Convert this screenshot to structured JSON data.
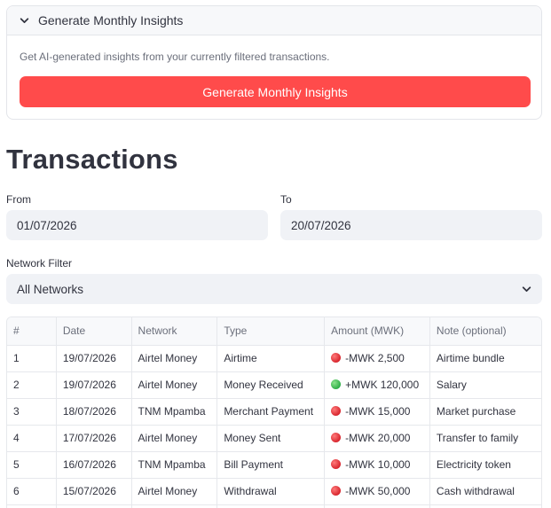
{
  "expander": {
    "title": "Generate Monthly Insights",
    "description": "Get AI-generated insights from your currently filtered transactions.",
    "button_label": "Generate Monthly Insights"
  },
  "page_title": "Transactions",
  "filters": {
    "from_label": "From",
    "from_value": "01/07/2026",
    "to_label": "To",
    "to_value": "20/07/2026",
    "network_label": "Network Filter",
    "network_value": "All Networks"
  },
  "colors": {
    "primary": "#ff4b4b",
    "negative": "#d8262e",
    "positive": "#2fae48"
  },
  "table": {
    "headers": [
      "#",
      "Date",
      "Network",
      "Type",
      "Amount (MWK)",
      "Note (optional)"
    ],
    "rows": [
      {
        "num": "1",
        "date": "19/07/2026",
        "network": "Airtel Money",
        "type": "Airtime",
        "sign": "negative",
        "amount": "-MWK 2,500",
        "note": "Airtime bundle"
      },
      {
        "num": "2",
        "date": "19/07/2026",
        "network": "Airtel Money",
        "type": "Money Received",
        "sign": "positive",
        "amount": "+MWK 120,000",
        "note": "Salary"
      },
      {
        "num": "3",
        "date": "18/07/2026",
        "network": "TNM Mpamba",
        "type": "Merchant Payment",
        "sign": "negative",
        "amount": "-MWK 15,000",
        "note": "Market purchase"
      },
      {
        "num": "4",
        "date": "17/07/2026",
        "network": "Airtel Money",
        "type": "Money Sent",
        "sign": "negative",
        "amount": "-MWK 20,000",
        "note": "Transfer to family"
      },
      {
        "num": "5",
        "date": "16/07/2026",
        "network": "TNM Mpamba",
        "type": "Bill Payment",
        "sign": "negative",
        "amount": "-MWK 10,000",
        "note": "Electricity token"
      },
      {
        "num": "6",
        "date": "15/07/2026",
        "network": "Airtel Money",
        "type": "Withdrawal",
        "sign": "negative",
        "amount": "-MWK 50,000",
        "note": "Cash withdrawal"
      }
    ]
  }
}
